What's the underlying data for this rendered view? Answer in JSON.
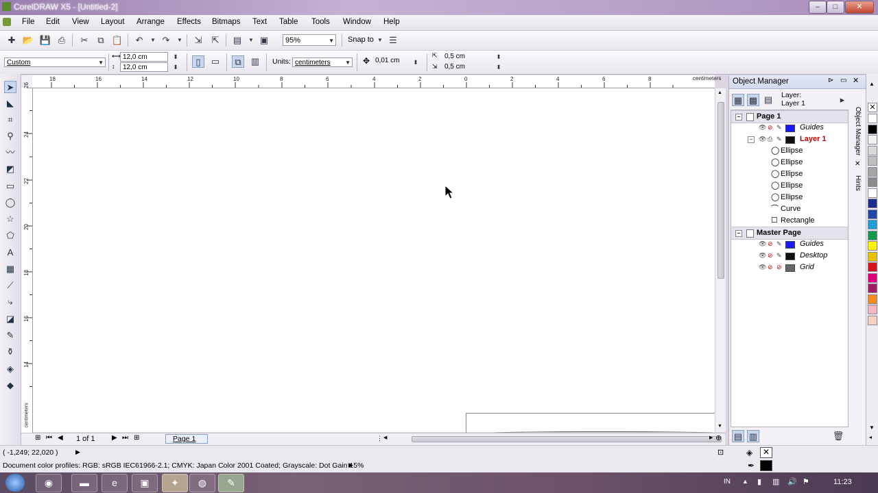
{
  "window": {
    "title": "CorelDRAW X5 - [Untitled-2]",
    "minimize": "–",
    "maximize": "□",
    "close": "✕"
  },
  "menu": {
    "items": [
      "File",
      "Edit",
      "View",
      "Layout",
      "Arrange",
      "Effects",
      "Bitmaps",
      "Text",
      "Table",
      "Tools",
      "Window",
      "Help"
    ]
  },
  "toolbar": {
    "zoom": "95%",
    "snap_to": "Snap to",
    "icons": [
      "new-icon",
      "open-icon",
      "save-icon",
      "print-icon",
      "cut-icon",
      "copy-icon",
      "paste-icon",
      "undo-icon",
      "redo-icon",
      "import-icon",
      "export-icon",
      "app-launcher-icon",
      "welcome-icon"
    ]
  },
  "propbar": {
    "preset": "Custom",
    "width": "12,0 cm",
    "height": "12,0 cm",
    "units_label": "Units:",
    "units": "centimeters",
    "nudge": "0,01 cm",
    "dup_x": "0,5 cm",
    "dup_y": "0,5 cm"
  },
  "ruler": {
    "h_ticks": [
      "18",
      "16",
      "14",
      "12",
      "10",
      "8",
      "6",
      "4",
      "2",
      "0",
      "2",
      "4",
      "6",
      "8",
      "10"
    ],
    "h_unit": "centimeters",
    "v_ticks": [
      "26",
      "24",
      "22",
      "20",
      "18",
      "16",
      "14"
    ],
    "v_unit": "centimeters"
  },
  "bottombar": {
    "page_count": "1 of 1",
    "page_tab": "Page 1"
  },
  "docker": {
    "title": "Object Manager",
    "layer_label": "Layer:",
    "layer_name": "Layer 1",
    "tree": {
      "page1": "Page 1",
      "guides": "Guides",
      "layer1": "Layer 1",
      "objects": [
        "Ellipse",
        "Ellipse",
        "Ellipse",
        "Ellipse",
        "Ellipse",
        "Curve",
        "Rectangle"
      ],
      "master": "Master Page",
      "master_guides": "Guides",
      "desktop": "Desktop",
      "grid": "Grid"
    },
    "side_tabs": [
      "Object Manager",
      "Hints"
    ],
    "colors": {
      "guides": "#1a1aff",
      "layer1": "#111111",
      "desktop": "#111111",
      "grid": "#666666",
      "layer1_text": "#c00000"
    }
  },
  "palette": {
    "colors": [
      "#ffffff",
      "#000000",
      "#f2f2f2",
      "#d9d9d9",
      "#bfbfbf",
      "#a6a6a6",
      "#8c8c8c",
      "#ffffff",
      "#1a2c8c",
      "#1f49a8",
      "#1c9cd8",
      "#159a4a",
      "#fff200",
      "#e8c400",
      "#d6141e",
      "#e0007a",
      "#9e1f63",
      "#f28c1e",
      "#f5b7c6",
      "#f7d0c2"
    ]
  },
  "status": {
    "coords": "( -1,249; 22,020 )",
    "color_profiles": "Document color profiles: RGB: sRGB IEC61966-2.1; CMYK: Japan Color 2001 Coated; Grayscale: Dot Gain 15%"
  },
  "taskbar": {
    "lang": "IN",
    "time": "11:23"
  }
}
